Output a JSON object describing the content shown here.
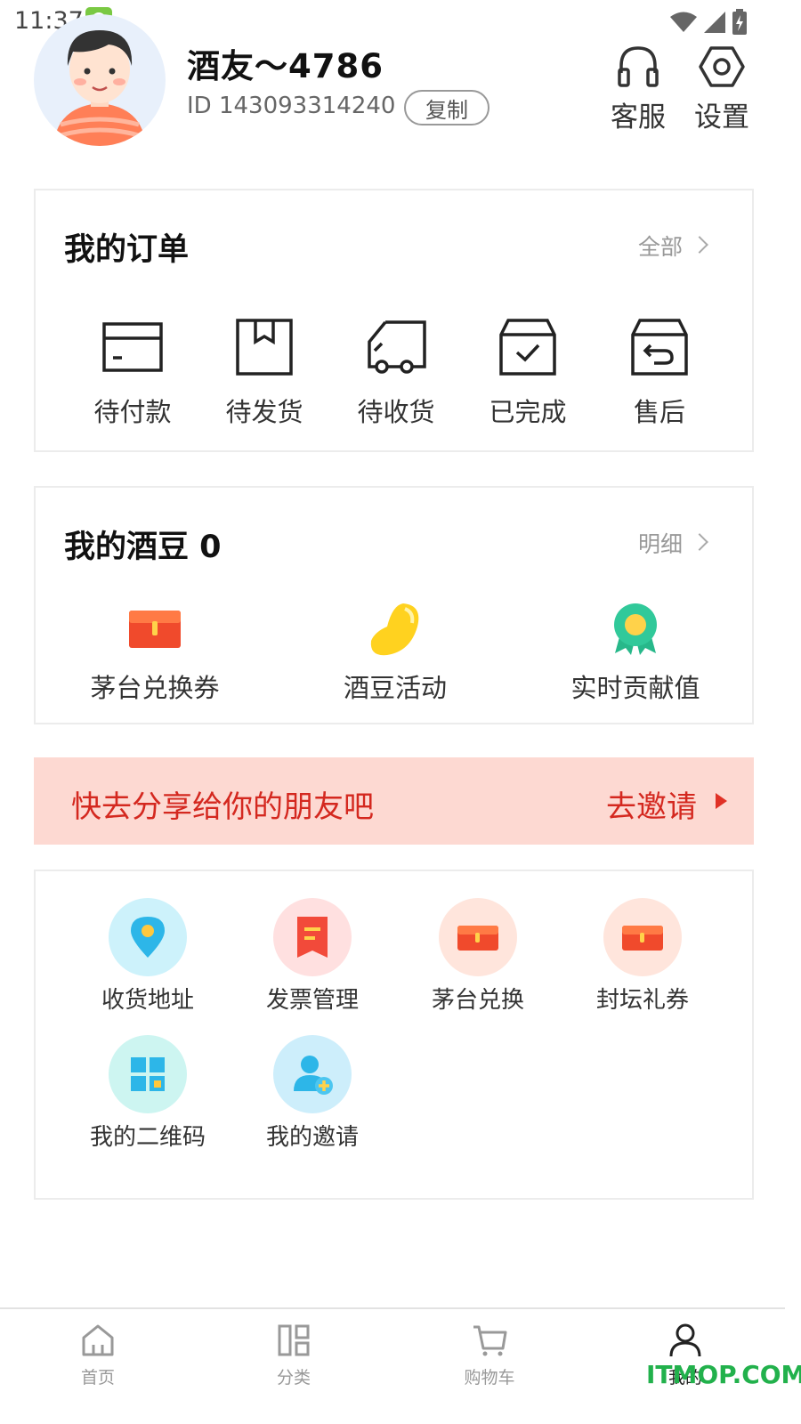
{
  "status_bar": {
    "time": "11:37"
  },
  "profile": {
    "username": "酒友～4786",
    "id_text": "ID 143093314240",
    "copy_label": "复制"
  },
  "header_actions": {
    "service": {
      "label": "客服",
      "icon": "headset-icon"
    },
    "settings": {
      "label": "设置",
      "icon": "gear-icon"
    }
  },
  "orders": {
    "title": "我的订单",
    "link_label": "全部",
    "items": [
      {
        "label": "待付款",
        "icon": "card-icon"
      },
      {
        "label": "待发货",
        "icon": "box-icon"
      },
      {
        "label": "待收货",
        "icon": "truck-icon"
      },
      {
        "label": "已完成",
        "icon": "box-check-icon"
      },
      {
        "label": "售后",
        "icon": "box-return-icon"
      }
    ]
  },
  "beans": {
    "title": "我的酒豆 0",
    "link_label": "明细",
    "items": [
      {
        "label": "茅台兑换券",
        "icon": "coupon-icon"
      },
      {
        "label": "酒豆活动",
        "icon": "bean-icon"
      },
      {
        "label": "实时贡献值",
        "icon": "medal-icon"
      }
    ]
  },
  "invite_banner": {
    "text": "快去分享给你的朋友吧",
    "action": "去邀请"
  },
  "tools": {
    "items": [
      {
        "label": "收货地址",
        "icon": "location-icon"
      },
      {
        "label": "发票管理",
        "icon": "invoice-icon"
      },
      {
        "label": "茅台兑换",
        "icon": "coupon-icon"
      },
      {
        "label": "封坛礼券",
        "icon": "coupon-icon"
      },
      {
        "label": "我的二维码",
        "icon": "qr-code-icon"
      },
      {
        "label": "我的邀请",
        "icon": "add-user-icon"
      }
    ]
  },
  "bottom_nav": {
    "items": [
      {
        "label": "首页",
        "icon": "home-icon"
      },
      {
        "label": "分类",
        "icon": "category-icon"
      },
      {
        "label": "购物车",
        "icon": "cart-icon"
      },
      {
        "label": "我的",
        "icon": "user-icon",
        "active": true
      }
    ]
  },
  "watermark": "ITMOP.COM",
  "colors": {
    "accent_red": "#d4281f",
    "banner_bg": "#fdd9d2",
    "text_dark": "#111111",
    "text_gray": "#999999"
  }
}
